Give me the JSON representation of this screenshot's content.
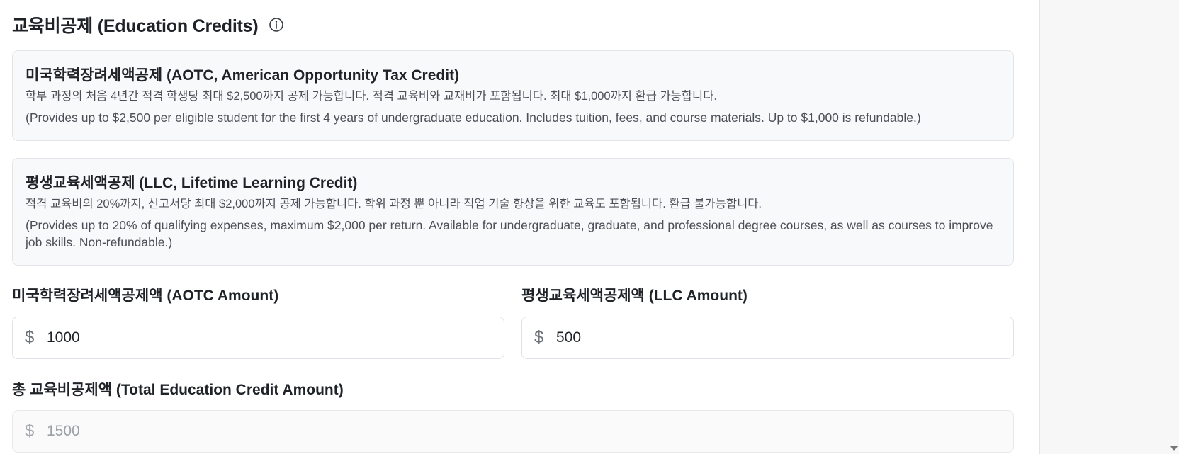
{
  "section": {
    "title": "교육비공제 (Education Credits)",
    "info_icon": "info-circle-icon"
  },
  "cards": {
    "aotc": {
      "title": "미국학력장려세액공제 (AOTC, American Opportunity Tax Credit)",
      "desc_ko": "학부 과정의 처음 4년간 적격 학생당 최대 $2,500까지 공제 가능합니다. 적격 교육비와 교재비가 포함됩니다. 최대 $1,000까지 환급 가능합니다.",
      "desc_en": "(Provides up to $2,500 per eligible student for the first 4 years of undergraduate education. Includes tuition, fees, and course materials. Up to $1,000 is refundable.)"
    },
    "llc": {
      "title": "평생교육세액공제 (LLC, Lifetime Learning Credit)",
      "desc_ko": "적격 교육비의 20%까지, 신고서당 최대 $2,000까지 공제 가능합니다. 학위 과정 뿐 아니라 직업 기술 향상을 위한 교육도 포함됩니다. 환급 불가능합니다.",
      "desc_en": "(Provides up to 20% of qualifying expenses, maximum $2,000 per return. Available for undergraduate, graduate, and professional degree courses, as well as courses to improve job skills. Non-refundable.)"
    }
  },
  "fields": {
    "aotc": {
      "label": "미국학력장려세액공제액 (AOTC Amount)",
      "prefix": "$",
      "value": "1000"
    },
    "llc": {
      "label": "평생교육세액공제액 (LLC Amount)",
      "prefix": "$",
      "value": "500"
    },
    "total": {
      "label": "총 교육비공제액 (Total Education Credit Amount)",
      "prefix": "$",
      "value": "1500"
    }
  },
  "colors": {
    "card_bg": "#f8f9fa",
    "card_border": "#e3e5e8",
    "text_primary": "#1f2328",
    "text_secondary": "#4b5058",
    "sidebar_bg": "#f7f7f8"
  }
}
